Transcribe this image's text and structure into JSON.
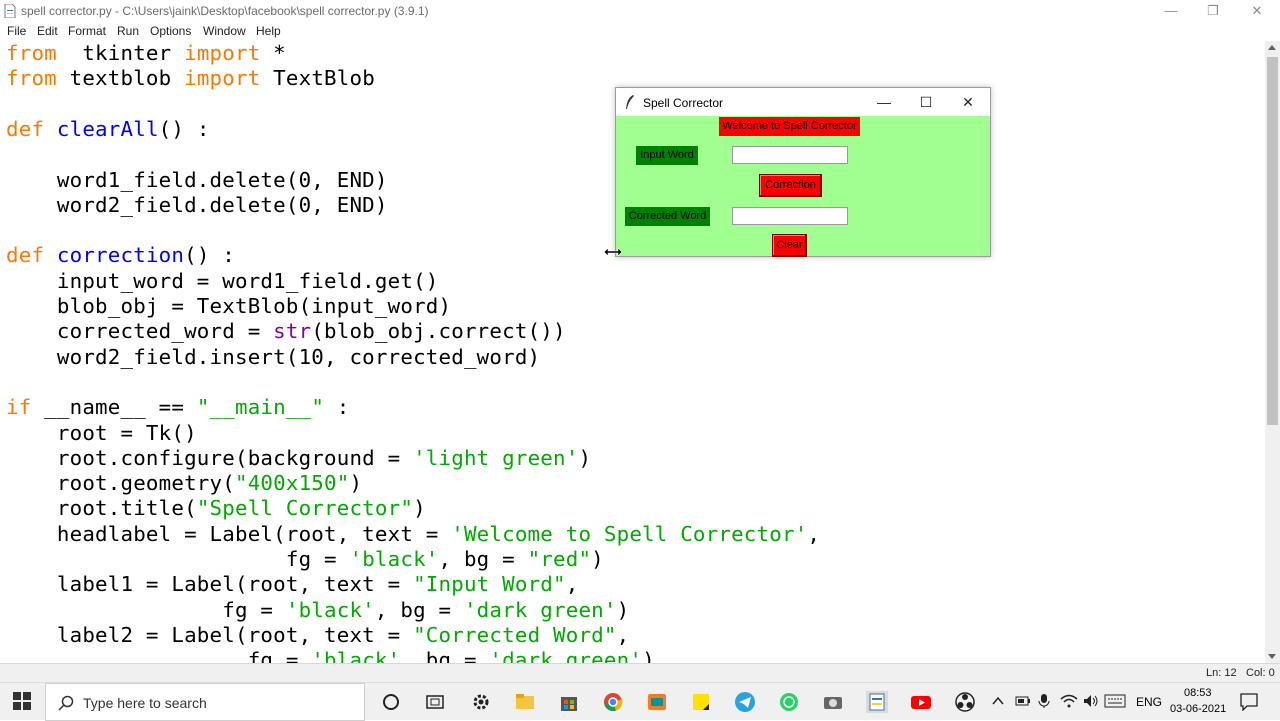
{
  "window": {
    "title": "spell corrector.py - C:\\Users\\jaink\\Desktop\\facebook\\spell corrector.py (3.9.1)"
  },
  "menu": [
    "File",
    "Edit",
    "Format",
    "Run",
    "Options",
    "Window",
    "Help"
  ],
  "code": [
    [
      [
        "kw",
        "from"
      ],
      [
        "",
        "  tkinter "
      ],
      [
        "kw",
        "import"
      ],
      [
        "",
        " *"
      ]
    ],
    [
      [
        "kw",
        "from"
      ],
      [
        "",
        " textblob "
      ],
      [
        "kw",
        "import"
      ],
      [
        "",
        " TextBlob"
      ]
    ],
    [],
    [
      [
        "kw",
        "def"
      ],
      [
        "fn",
        " clearAll"
      ],
      [
        "",
        "() :"
      ]
    ],
    [],
    [
      [
        "",
        "    word1_field.delete(0, END)"
      ]
    ],
    [
      [
        "",
        "    word2_field.delete(0, END)"
      ]
    ],
    [],
    [
      [
        "kw",
        "def"
      ],
      [
        "fn",
        " correction"
      ],
      [
        "",
        "() :"
      ]
    ],
    [
      [
        "",
        "    input_word = word1_field.get()"
      ]
    ],
    [
      [
        "",
        "    blob_obj = TextBlob(input_word)"
      ]
    ],
    [
      [
        "",
        "    corrected_word = "
      ],
      [
        "bi",
        "str"
      ],
      [
        "",
        "(blob_obj.correct())"
      ]
    ],
    [
      [
        "",
        "    word2_field.insert(10, corrected_word)"
      ]
    ],
    [],
    [
      [
        "kw",
        "if"
      ],
      [
        "",
        " __name__ == "
      ],
      [
        "st",
        "\"__main__\""
      ],
      [
        "",
        " :"
      ]
    ],
    [
      [
        "",
        "    root = Tk()"
      ]
    ],
    [
      [
        "",
        "    root.configure(background = "
      ],
      [
        "st",
        "'light green'"
      ],
      [
        "",
        ")"
      ]
    ],
    [
      [
        "",
        "    root.geometry("
      ],
      [
        "st",
        "\"400x150\""
      ],
      [
        "",
        ")"
      ]
    ],
    [
      [
        "",
        "    root.title("
      ],
      [
        "st",
        "\"Spell Corrector\""
      ],
      [
        "",
        ")"
      ]
    ],
    [
      [
        "",
        "    headlabel = Label(root, text = "
      ],
      [
        "st",
        "'Welcome to Spell Corrector'"
      ],
      [
        "",
        ","
      ]
    ],
    [
      [
        "",
        "                      fg = "
      ],
      [
        "st",
        "'black'"
      ],
      [
        "",
        ", bg = "
      ],
      [
        "st",
        "\"red\""
      ],
      [
        "",
        ")"
      ]
    ],
    [
      [
        "",
        "    label1 = Label(root, text = "
      ],
      [
        "st",
        "\"Input Word\""
      ],
      [
        "",
        ","
      ]
    ],
    [
      [
        "",
        "                 fg = "
      ],
      [
        "st",
        "'black'"
      ],
      [
        "",
        ", bg = "
      ],
      [
        "st",
        "'dark green'"
      ],
      [
        "",
        ")"
      ]
    ],
    [
      [
        "",
        "    label2 = Label(root, text = "
      ],
      [
        "st",
        "\"Corrected Word\""
      ],
      [
        "",
        ","
      ]
    ],
    [
      [
        "",
        "                   fg = "
      ],
      [
        "st",
        "'black'"
      ],
      [
        "",
        ", bg = "
      ],
      [
        "st",
        "'dark green'"
      ],
      [
        "",
        ")"
      ]
    ]
  ],
  "status": {
    "line": "Ln: 12",
    "col": "Col: 0"
  },
  "tk_window": {
    "title": "Spell Corrector",
    "head_label": "Welcome to Spell Corrector",
    "input_label": "Input Word",
    "correction_button": "Correction",
    "corrected_label": "Corrected Word",
    "clear_button": "Clear",
    "input_value": "",
    "output_value": ""
  },
  "taskbar": {
    "search_placeholder": "Type here to search",
    "language": "ENG",
    "time": "08:53",
    "date": "03-06-2021"
  },
  "colors": {
    "keyword": "#ff7700",
    "function": "#0000ff",
    "string": "#00aa00",
    "builtin": "#900090",
    "tk_background": "#a0ff90",
    "label_red": "#ff0000",
    "label_dark_green": "#008000"
  }
}
